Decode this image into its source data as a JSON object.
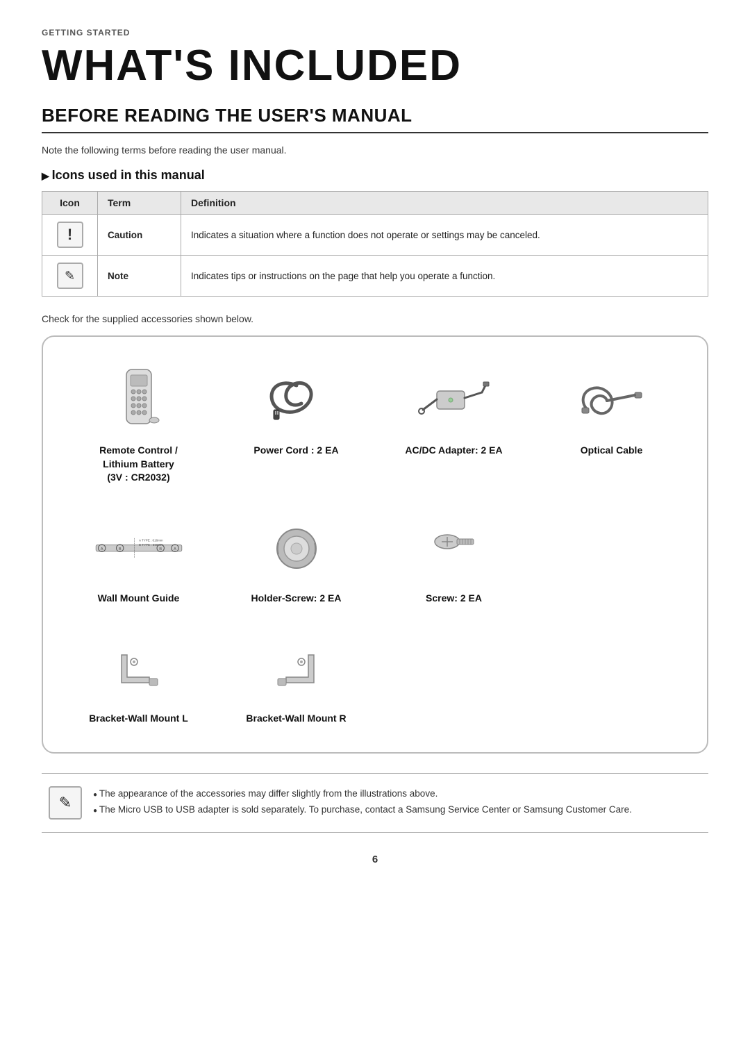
{
  "header": {
    "section": "GETTING STARTED",
    "title": "WHAT'S INCLUDED",
    "subtitle": "BEFORE READING THE USER'S MANUAL",
    "note": "Note the following terms before reading the user manual."
  },
  "icons_section": {
    "heading": "Icons used in this manual",
    "table": {
      "columns": [
        "Icon",
        "Term",
        "Definition"
      ],
      "rows": [
        {
          "icon_type": "caution",
          "term": "Caution",
          "definition": "Indicates a situation where a function does not operate or settings may be canceled."
        },
        {
          "icon_type": "note",
          "term": "Note",
          "definition": "Indicates tips or instructions on the page that help you operate a function."
        }
      ]
    }
  },
  "accessories": {
    "intro": "Check for the supplied accessories shown below.",
    "items_row1": [
      {
        "id": "remote-control",
        "label": "Remote Control /\nLithium Battery\n(3V : CR2032)"
      },
      {
        "id": "power-cord",
        "label": "Power Cord : 2 EA"
      },
      {
        "id": "ac-dc-adapter",
        "label": "AC/DC Adapter: 2 EA"
      },
      {
        "id": "optical-cable",
        "label": "Optical Cable"
      }
    ],
    "items_row2": [
      {
        "id": "wall-mount-guide",
        "label": "Wall Mount Guide"
      },
      {
        "id": "holder-screw",
        "label": "Holder-Screw: 2 EA"
      },
      {
        "id": "screw",
        "label": "Screw: 2 EA"
      },
      {
        "id": "empty",
        "label": ""
      }
    ],
    "items_row3": [
      {
        "id": "bracket-wall-l",
        "label": "Bracket-Wall Mount L"
      },
      {
        "id": "bracket-wall-r",
        "label": "Bracket-Wall Mount R"
      },
      {
        "id": "empty2",
        "label": ""
      },
      {
        "id": "empty3",
        "label": ""
      }
    ]
  },
  "notes": {
    "items": [
      "The appearance of the accessories may differ slightly from the illustrations above.",
      "The Micro USB to USB adapter is sold separately. To purchase, contact a Samsung Service Center or Samsung Customer Care."
    ]
  },
  "page": {
    "number": "6"
  }
}
